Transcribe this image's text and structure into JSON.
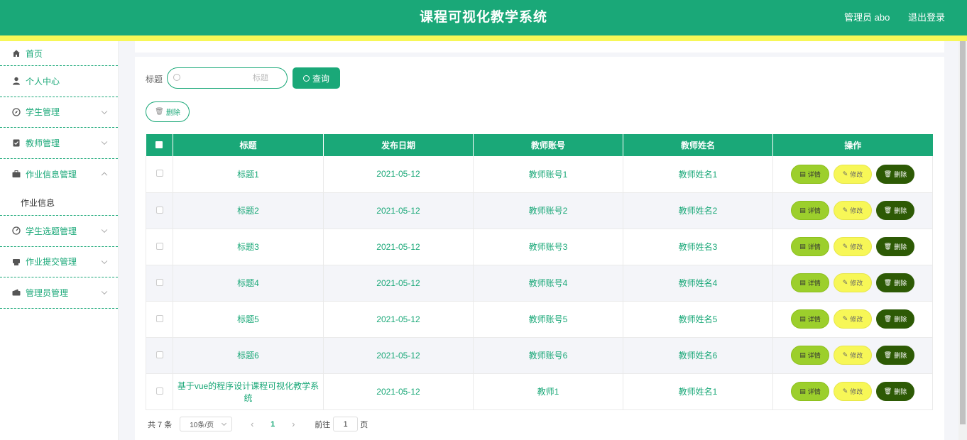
{
  "header": {
    "title": "课程可视化教学系统",
    "user": "管理员 abo",
    "logout": "退出登录"
  },
  "sidebar": {
    "items": [
      {
        "label": "首页",
        "icon": "home-icon"
      },
      {
        "label": "个人中心",
        "icon": "user-icon"
      },
      {
        "label": "学生管理",
        "icon": "compass-icon"
      },
      {
        "label": "教师管理",
        "icon": "clipboard-icon"
      },
      {
        "label": "作业信息管理",
        "icon": "briefcase-icon"
      },
      {
        "label": "学生选题管理",
        "icon": "gauge-icon"
      },
      {
        "label": "作业提交管理",
        "icon": "printer-icon"
      },
      {
        "label": "管理员管理",
        "icon": "wallet-icon"
      }
    ],
    "submenu": "作业信息"
  },
  "search": {
    "label": "标题",
    "placeholder": "标题",
    "query_label": "查询",
    "delete_label": "删除"
  },
  "table": {
    "columns": [
      "标题",
      "发布日期",
      "教师账号",
      "教师姓名",
      "操作"
    ],
    "rows": [
      {
        "title": "标题1",
        "date": "2021-05-12",
        "account": "教师账号1",
        "name": "教师姓名1"
      },
      {
        "title": "标题2",
        "date": "2021-05-12",
        "account": "教师账号2",
        "name": "教师姓名2"
      },
      {
        "title": "标题3",
        "date": "2021-05-12",
        "account": "教师账号3",
        "name": "教师姓名3"
      },
      {
        "title": "标题4",
        "date": "2021-05-12",
        "account": "教师账号4",
        "name": "教师姓名4"
      },
      {
        "title": "标题5",
        "date": "2021-05-12",
        "account": "教师账号5",
        "name": "教师姓名5"
      },
      {
        "title": "标题6",
        "date": "2021-05-12",
        "account": "教师账号6",
        "name": "教师姓名6"
      },
      {
        "title": "基于vue的程序设计课程可视化教学系统",
        "date": "2021-05-12",
        "account": "教师1",
        "name": "教师姓名1"
      }
    ],
    "actions": {
      "detail": "详情",
      "edit": "修改",
      "remove": "删除"
    }
  },
  "pagination": {
    "total": "共 7 条",
    "page_size": "10条/页",
    "current": "1",
    "goto_label": "前往",
    "goto_value": "1",
    "unit": "页"
  },
  "colors": {
    "primary": "#1aa878",
    "accent_yellow": "#f7f757",
    "detail": "#9ccf2c",
    "remove": "#2d5a05"
  }
}
